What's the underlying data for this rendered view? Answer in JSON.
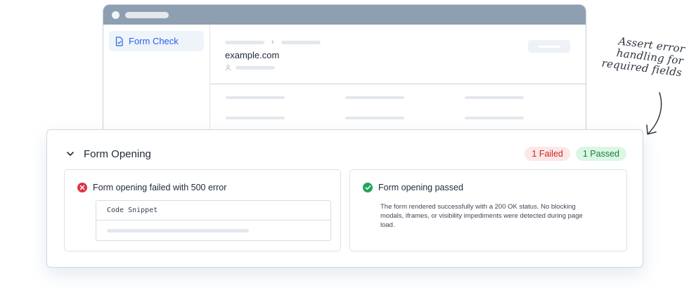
{
  "browser": {
    "sidebar": {
      "nav_item_label": "Form Check",
      "nav_item_icon": "file-check-icon"
    },
    "header": {
      "site_name": "example.com",
      "breadcrumb_separator": "›"
    }
  },
  "annotation": {
    "lines": [
      "Assert error",
      "handling for",
      "required fields"
    ]
  },
  "panel": {
    "title": "Form Opening",
    "badges": {
      "failed": "1 Failed",
      "passed": "1 Passed"
    },
    "cards": {
      "failed": {
        "title": "Form opening failed with 500 error",
        "snippet_label": "Code Snippet"
      },
      "passed": {
        "title": "Form opening passed",
        "description": "The form rendered successfully with a 200 OK status. No blocking modals, iframes, or visibility impediments were detected during page load."
      }
    }
  },
  "colors": {
    "accent": "#2563eb",
    "fail": "#dc3545",
    "fail_badge_bg": "#fde7e7",
    "pass": "#22a559",
    "pass_badge_bg": "#dcf6e5",
    "browser_bar": "#8e9fb1"
  }
}
